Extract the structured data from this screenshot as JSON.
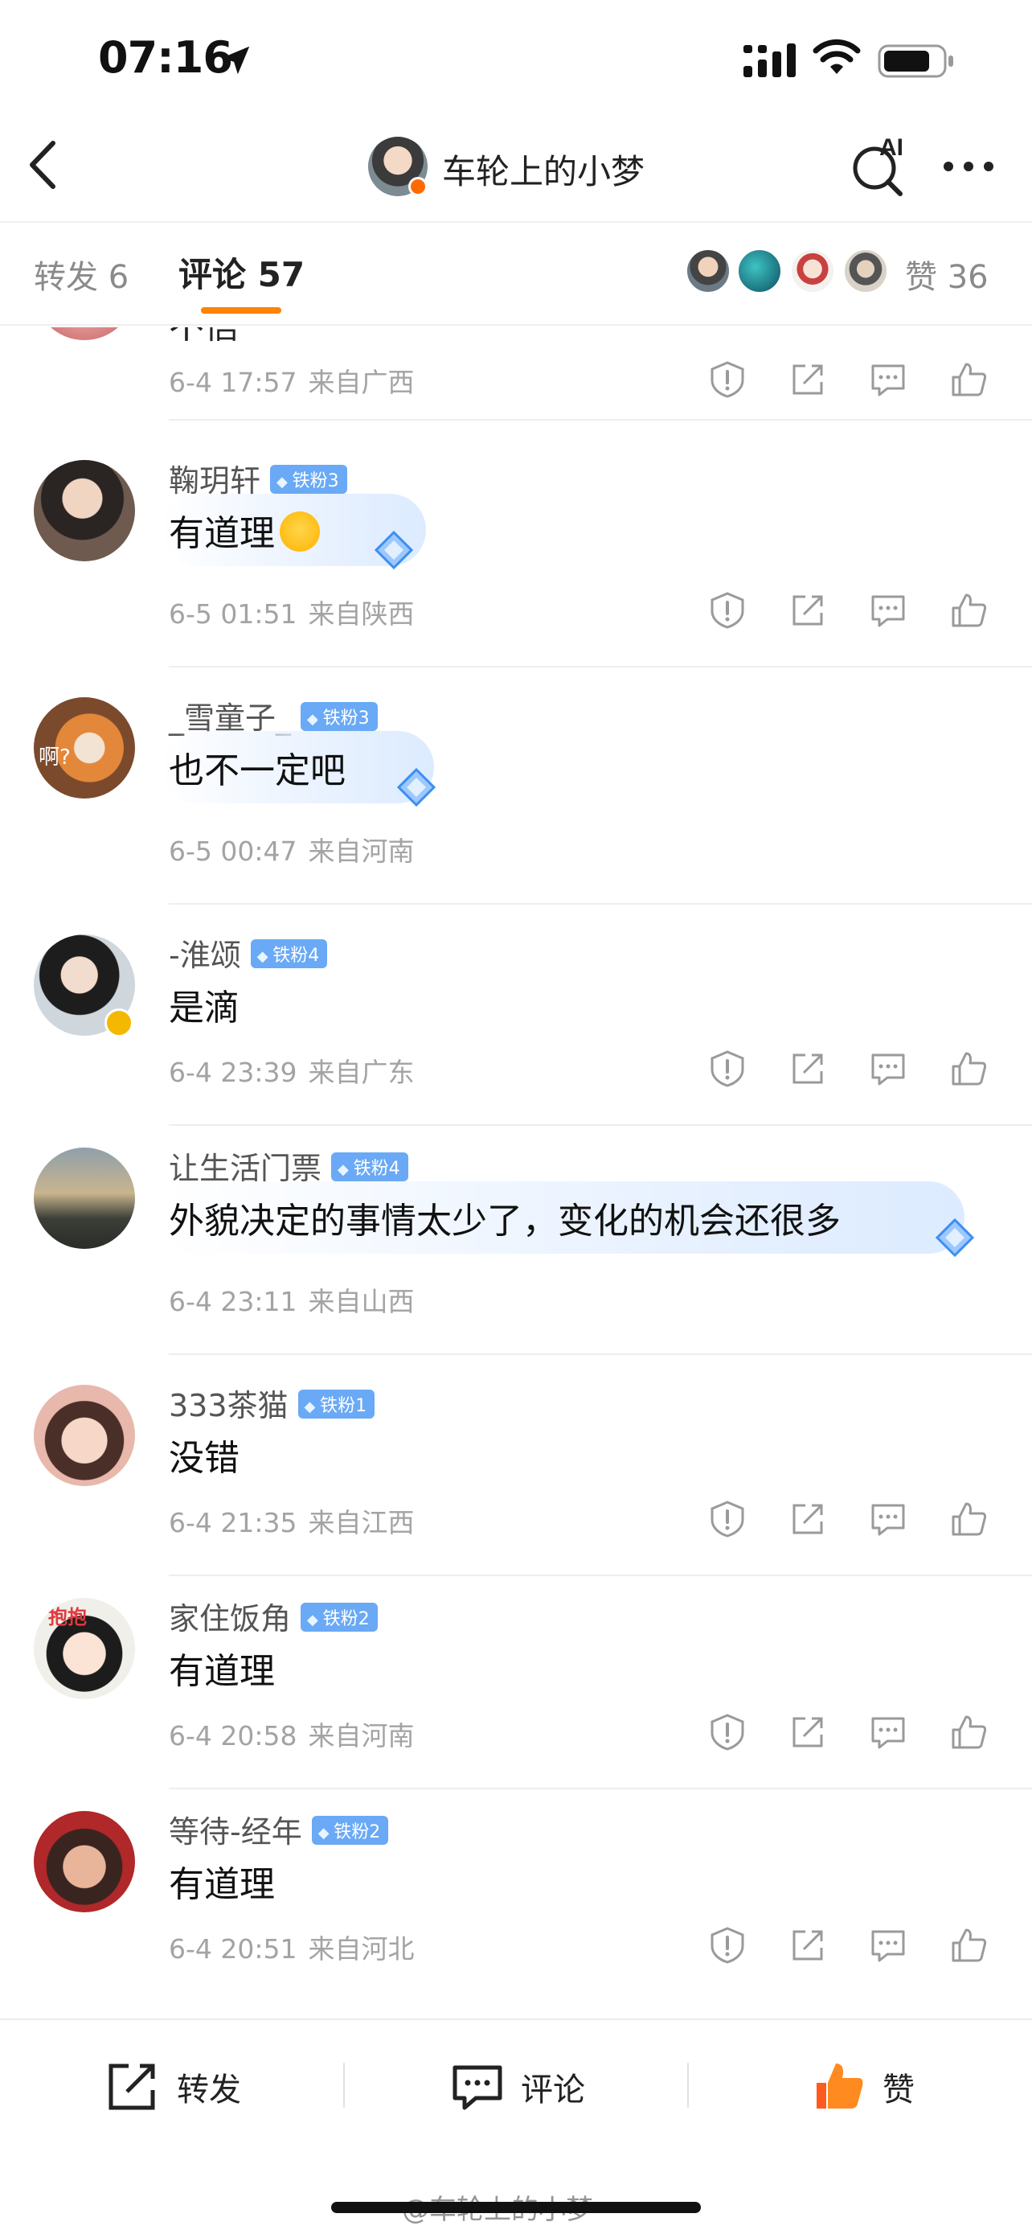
{
  "status_bar": {
    "time": "07:16"
  },
  "nav": {
    "title": "车轮上的小梦",
    "ai_label": "AI"
  },
  "tabs": {
    "repost": "转发 6",
    "comments": "评论 57",
    "likes": "赞 36"
  },
  "partial_comment": {
    "text": "不信",
    "time": "6-4 17:57",
    "location": "来自广西"
  },
  "comments": [
    {
      "name": "鞠玥轩",
      "badge": "铁粉3",
      "text": "有道理",
      "time": "6-5 01:51",
      "location": "来自陕西",
      "bubble": true,
      "emoji": true
    },
    {
      "name": "_雪童子_",
      "badge": "铁粉3",
      "text": "也不一定吧",
      "time": "6-5 00:47",
      "location": "来自河南",
      "bubble": true,
      "avatar_text": "啊?"
    },
    {
      "name": "-淮颂",
      "badge": "铁粉4",
      "text": "是滴",
      "time": "6-4 23:39",
      "location": "来自广东",
      "verified": true
    },
    {
      "name": "让生活门票",
      "badge": "铁粉4",
      "text": "外貌决定的事情太少了，变化的机会还很多",
      "time": "6-4 23:11",
      "location": "来自山西",
      "bubble": true
    },
    {
      "name": "333茶猫",
      "badge": "铁粉1",
      "text": "没错",
      "time": "6-4 21:35",
      "location": "来自江西"
    },
    {
      "name": "家住饭角",
      "badge": "铁粉2",
      "text": "有道理",
      "time": "6-4 20:58",
      "location": "来自河南",
      "avatar_text": "抱抱"
    },
    {
      "name": "等待-经年",
      "badge": "铁粉2",
      "text": "有道理",
      "time": "6-4 20:51",
      "location": "来自河北"
    }
  ],
  "bottom_bar": {
    "repost": "转发",
    "comment": "评论",
    "like": "赞"
  },
  "watermark": "@车轮上的小梦",
  "colors": {
    "accent": "#ff8200",
    "badge": "#6aa9f5",
    "meta": "#a3a3a3"
  },
  "icons": [
    "location-arrow-icon",
    "signal-icon",
    "wifi-icon",
    "battery-icon",
    "back-icon",
    "ai-search-icon",
    "more-icon",
    "report-icon",
    "share-icon",
    "comment-icon",
    "like-icon",
    "diamond-gem-icon"
  ]
}
